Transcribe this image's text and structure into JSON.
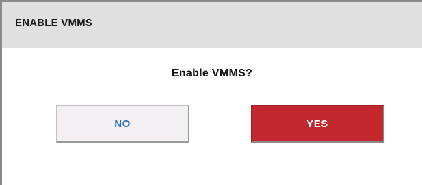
{
  "dialog": {
    "title": "ENABLE VMMS",
    "prompt": "Enable VMMS?",
    "buttons": {
      "no_label": "NO",
      "yes_label": "YES"
    }
  },
  "colors": {
    "title_bar_bg": "#e0e0e0",
    "no_button_bg": "#f3eff3",
    "no_button_text": "#2e6fb5",
    "yes_button_bg": "#c1272d",
    "yes_button_text": "#ffffff"
  }
}
